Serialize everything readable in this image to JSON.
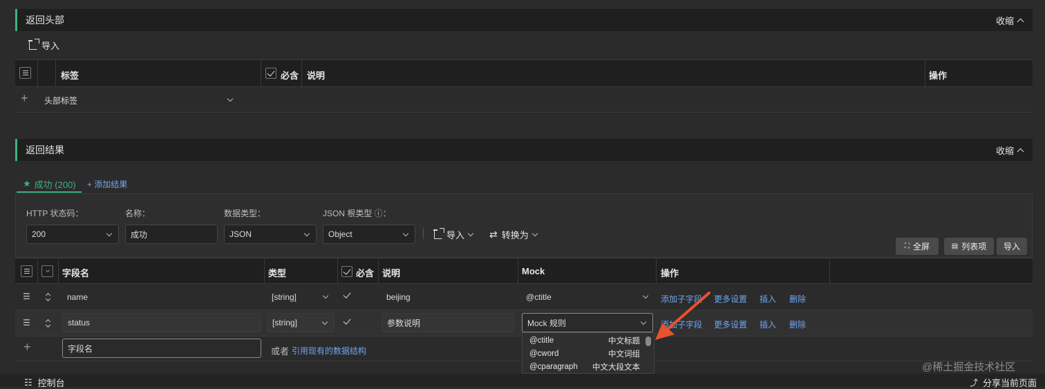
{
  "header_section": {
    "title": "返回头部",
    "collapse_label": "收缩",
    "import_label": "导入",
    "columns": {
      "tag": "标签",
      "required": "必含",
      "desc": "说明",
      "ops": "操作"
    },
    "new_row_placeholder": "头部标签"
  },
  "result_section": {
    "title": "返回结果",
    "collapse_label": "收缩",
    "tabs": [
      {
        "label": "成功 (200)"
      }
    ],
    "add_result_label": "+ 添加结果",
    "form": {
      "http_status_label": "HTTP 状态码：",
      "http_status_value": "200",
      "name_label": "名称：",
      "name_value": "成功",
      "data_type_label": "数据类型：",
      "data_type_value": "JSON",
      "json_root_label": "JSON 根类型 ⓘ：",
      "json_root_value": "Object",
      "import_label": "导入",
      "convert_label": "转换为"
    },
    "toolbar": {
      "fullscreen": "全屏",
      "list_items": "列表项",
      "import": "导入"
    },
    "columns": {
      "field": "字段名",
      "type": "类型",
      "required": "必含",
      "desc": "说明",
      "mock": "Mock",
      "ops": "操作"
    },
    "rows": [
      {
        "field": "name",
        "type": "[string]",
        "desc": "beijing",
        "mock": "@ctitle",
        "actions": [
          "添加子字段",
          "更多设置",
          "插入",
          "删除"
        ]
      },
      {
        "field": "status",
        "type": "[string]",
        "desc": "参数说明",
        "mock": "Mock 规则",
        "actions": [
          "添加子字段",
          "更多设置",
          "插入",
          "删除"
        ]
      }
    ],
    "new_field_placeholder": "字段名",
    "or_label": "或者",
    "reference_link": "引用现有的数据结构",
    "mock_dropdown": [
      {
        "rule": "@ctitle",
        "desc": "中文标题"
      },
      {
        "rule": "@cword",
        "desc": "中文词组"
      },
      {
        "rule": "@cparagraph",
        "desc": "中文大段文本"
      }
    ]
  },
  "footer": {
    "console_label": "控制台",
    "share_label": "分享当前页面",
    "watermark": "@稀土掘金技术社区"
  },
  "colors": {
    "accent": "#3fb27f",
    "link": "#6ea6f2",
    "arrow": "#e8522c"
  }
}
